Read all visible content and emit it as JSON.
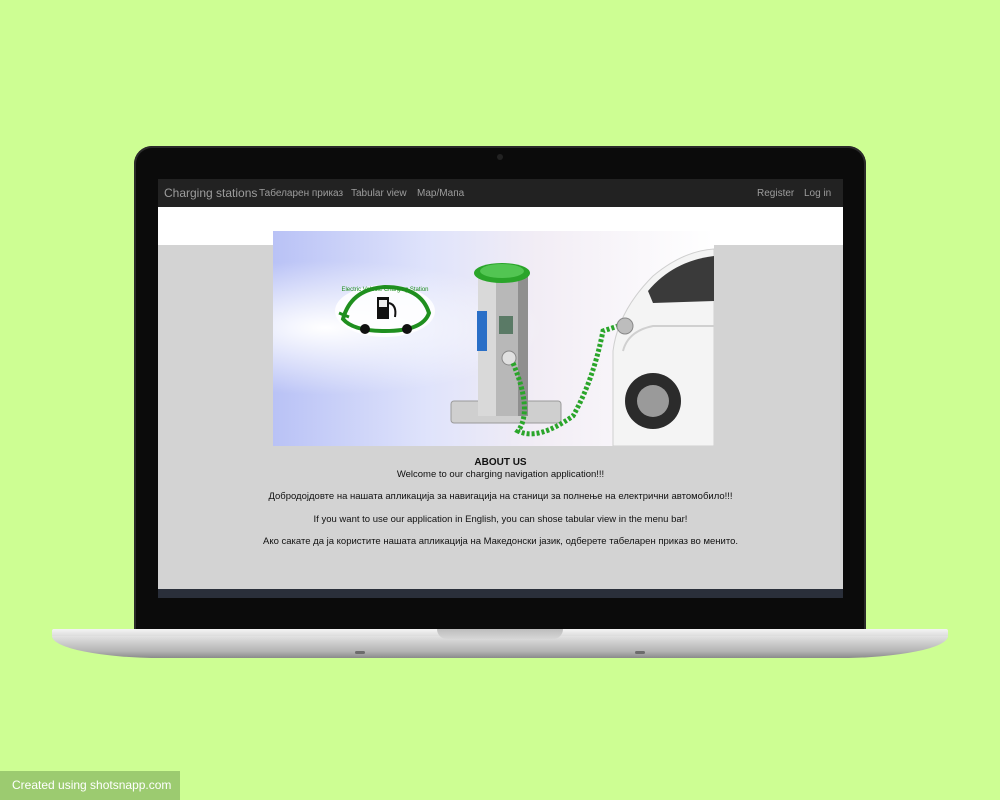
{
  "navbar": {
    "brand": "Charging stations",
    "links": [
      "Табеларен приказ",
      "Tabular view",
      "Map/Мапа"
    ],
    "right_links": [
      "Register",
      "Log in"
    ]
  },
  "hero": {
    "logo_text": "Electric Vehicle Charging Station"
  },
  "content": {
    "title": "ABOUT US",
    "line1": "Welcome to our charging navigation application!!!",
    "line2": "Добродојдовте на нашата апликација за навигација на станици за полнење на електрични автомобило!!!",
    "line3": "If you want to use our application in English, you can shose tabular view in the menu bar!",
    "line4": "Ако сакате да ја користите нашата апликација на Македонски јазик, одберете табеларен приказ во менито."
  },
  "watermark": "Created using shotsnapp.com",
  "colors": {
    "background": "#cdfe93",
    "navbar": "#222222",
    "nav_text": "#9d9d9d",
    "page": "#d3d3d3",
    "accent_green": "#2aa52a"
  }
}
